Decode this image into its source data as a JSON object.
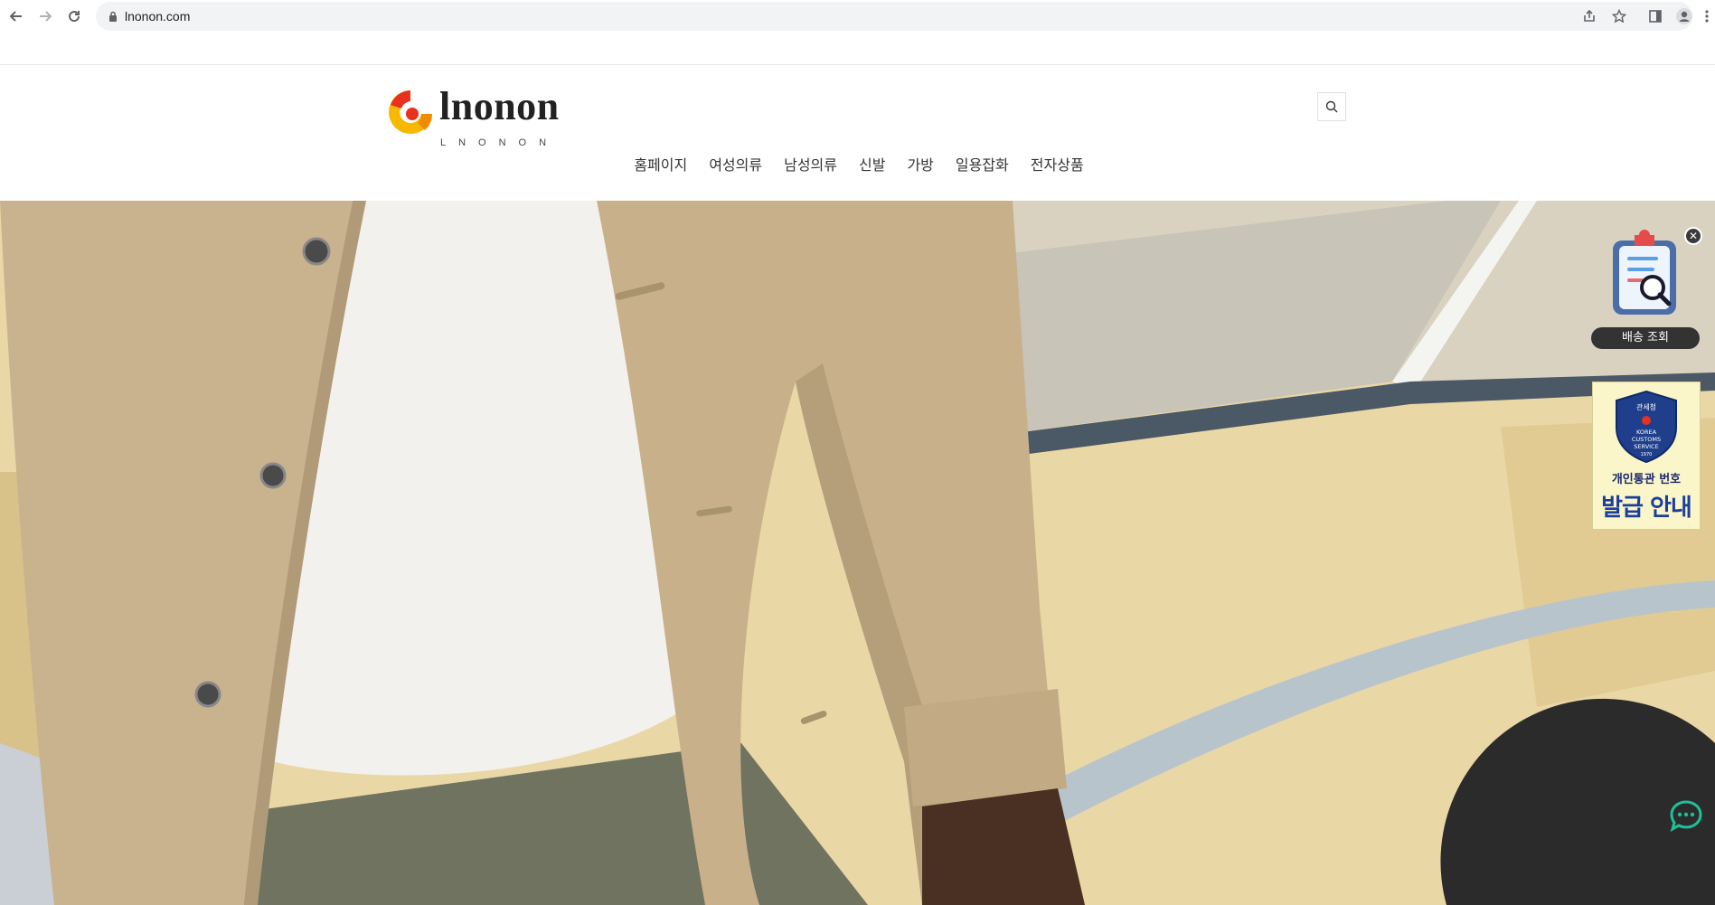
{
  "browser": {
    "url": "lnonon.com",
    "back_icon": "arrow-left-icon",
    "forward_icon": "arrow-right-icon",
    "reload_icon": "reload-icon"
  },
  "site": {
    "logo_text": "lnonon",
    "logo_subtext": "LNONON",
    "nav": [
      "홈페이지",
      "여성의류",
      "남성의류",
      "신발",
      "가방",
      "일용잡화",
      "전자상품"
    ]
  },
  "widgets": {
    "delivery_label": "배송 조회",
    "customs_badge_top": "관세청",
    "customs_badge_middle": "KOREA CUSTOMS SERVICE",
    "customs_badge_year": "1970",
    "customs_line1": "개인통관 번호",
    "customs_line2": "발급 안내"
  },
  "colors": {
    "accent_red": "#e8311e",
    "accent_yellow": "#f6b800",
    "chat_green": "#1fbf9a"
  }
}
